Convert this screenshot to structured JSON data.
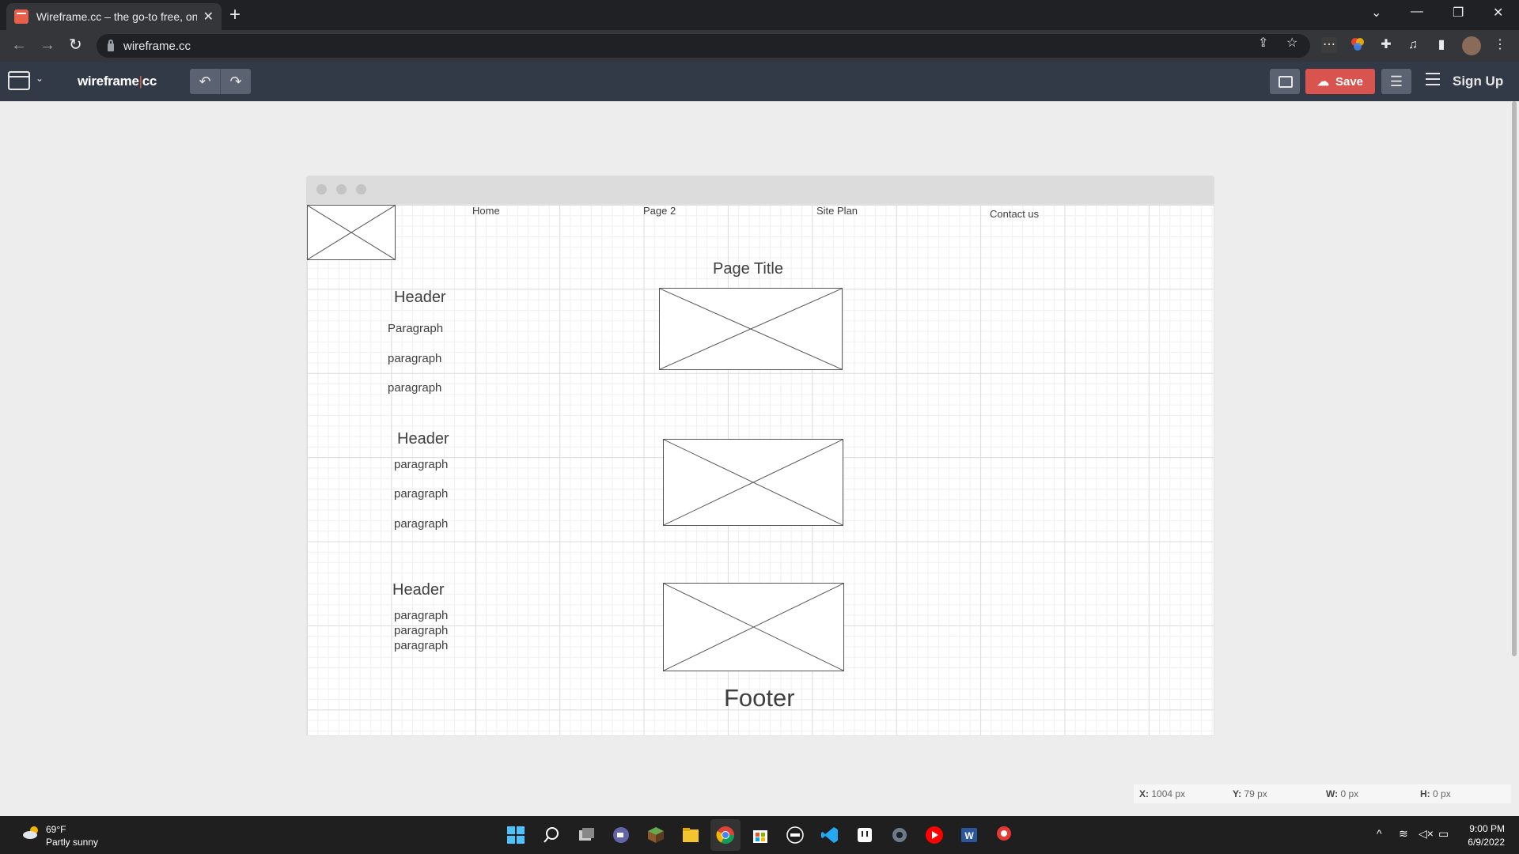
{
  "browser": {
    "tab_title": "Wireframe.cc – the go-to free, on",
    "url": "wireframe.cc"
  },
  "toolbar": {
    "brand_left": "wireframe",
    "brand_sep": "|",
    "brand_right": "cc",
    "undo_icon": "↶",
    "redo_icon": "↷",
    "save_label": "Save",
    "signup_label": "Sign Up"
  },
  "wireframe": {
    "nav": [
      "Home",
      "Page 2",
      "Site Plan",
      "Contact us"
    ],
    "page_title": "Page Title",
    "sections": [
      {
        "header": "Header",
        "paragraphs": [
          "Paragraph",
          "paragraph",
          "paragraph"
        ]
      },
      {
        "header": "Header",
        "paragraphs": [
          "paragraph",
          "paragraph",
          "paragraph"
        ]
      },
      {
        "header": "Header",
        "paragraphs": [
          "paragraph",
          "paragraph",
          "paragraph"
        ]
      }
    ],
    "footer": "Footer"
  },
  "readout": {
    "x_label": "X:",
    "x_value": "1004 px",
    "y_label": "Y:",
    "y_value": "79 px",
    "w_label": "W:",
    "w_value": "0 px",
    "h_label": "H:",
    "h_value": "0 px"
  },
  "taskbar": {
    "weather_temp": "69°F",
    "weather_desc": "Partly sunny",
    "time": "9:00 PM",
    "date": "6/9/2022"
  },
  "colors": {
    "accent": "#d9534f",
    "toolbar_bg": "#333a47",
    "canvas_bg": "#ededed"
  }
}
